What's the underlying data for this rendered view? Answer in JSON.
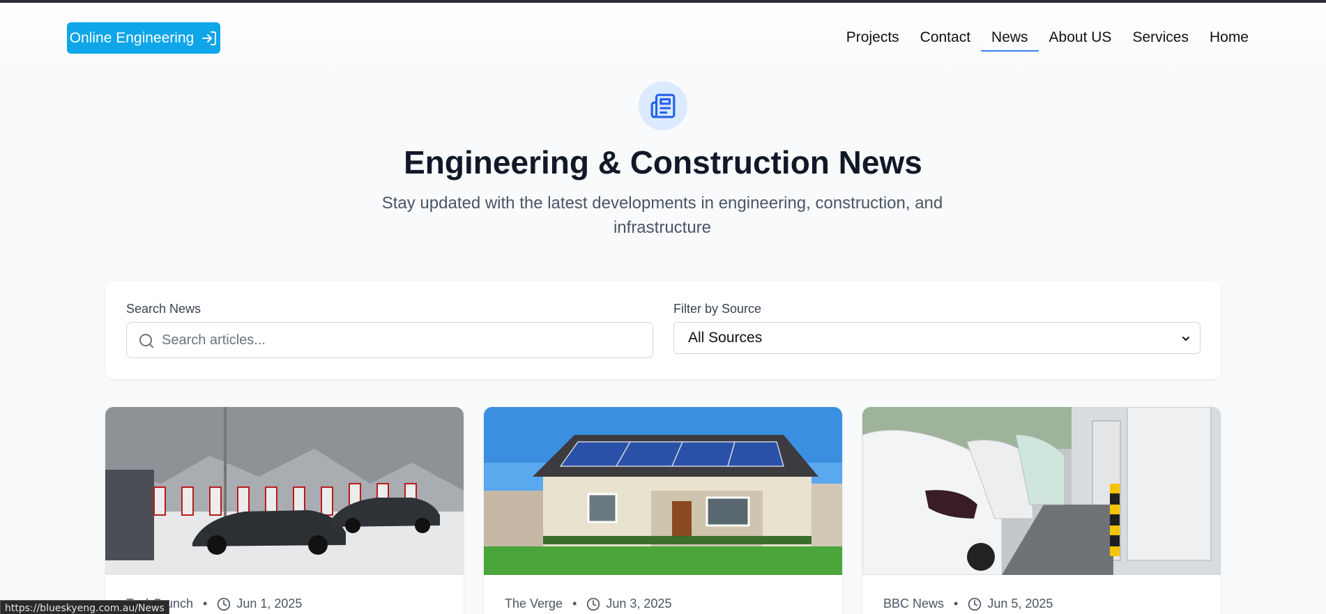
{
  "header": {
    "brand_label": "Online Engineering",
    "nav": [
      {
        "label": "Projects",
        "active": false
      },
      {
        "label": "Contact",
        "active": false
      },
      {
        "label": "News",
        "active": true
      },
      {
        "label": "About US",
        "active": false
      },
      {
        "label": "Services",
        "active": false
      },
      {
        "label": "Home",
        "active": false
      }
    ]
  },
  "hero": {
    "icon": "newspaper-icon",
    "title": "Engineering & Construction News",
    "subtitle": "Stay updated with the latest developments in engineering, construction, and infrastructure"
  },
  "filters": {
    "search_label": "Search News",
    "search_placeholder": "Search articles...",
    "source_label": "Filter by Source",
    "source_selected": "All Sources"
  },
  "articles": [
    {
      "source": "TechCrunch",
      "date": "Jun 1, 2025",
      "image": "snowy-ev-charging-station"
    },
    {
      "source": "The Verge",
      "date": "Jun 3, 2025",
      "image": "house-with-solar-panels"
    },
    {
      "source": "BBC News",
      "date": "Jun 5, 2025",
      "image": "ev-charging-bays"
    }
  ],
  "status_bar": {
    "url": "https://blueskyeng.com.au/News"
  },
  "colors": {
    "brand": "#0ea5e9",
    "accent": "#3b82f6",
    "background": "#f8fafc"
  }
}
